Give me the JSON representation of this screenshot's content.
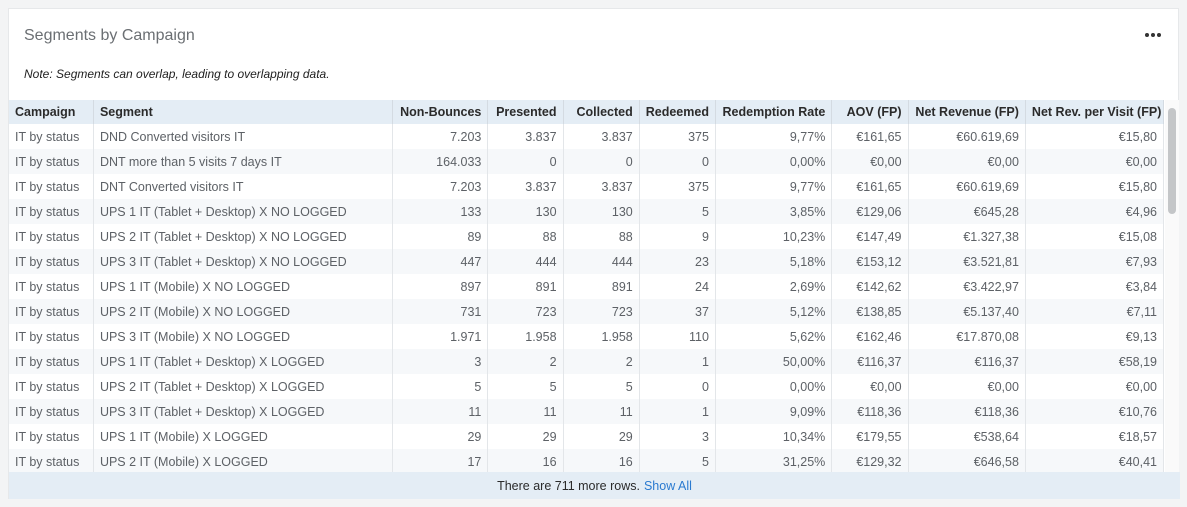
{
  "title": "Segments by Campaign",
  "menu_icon": "ellipsis-icon",
  "note": "Note: Segments can overlap, leading to overlapping data.",
  "columns": [
    "Campaign",
    "Segment",
    "Non-Bounces",
    "Presented",
    "Collected",
    "Redeemed",
    "Redemption Rate",
    "AOV (FP)",
    "Net Revenue (FP)",
    "Net Rev. per Visit (FP)"
  ],
  "rows": [
    [
      "IT by status",
      "DND Converted visitors IT",
      "7.203",
      "3.837",
      "3.837",
      "375",
      "9,77%",
      "€161,65",
      "€60.619,69",
      "€15,80"
    ],
    [
      "IT by status",
      "DNT more than 5 visits 7 days IT",
      "164.033",
      "0",
      "0",
      "0",
      "0,00%",
      "€0,00",
      "€0,00",
      "€0,00"
    ],
    [
      "IT by status",
      "DNT Converted visitors IT",
      "7.203",
      "3.837",
      "3.837",
      "375",
      "9,77%",
      "€161,65",
      "€60.619,69",
      "€15,80"
    ],
    [
      "IT by status",
      "UPS 1 IT (Tablet + Desktop) X NO LOGGED",
      "133",
      "130",
      "130",
      "5",
      "3,85%",
      "€129,06",
      "€645,28",
      "€4,96"
    ],
    [
      "IT by status",
      "UPS 2 IT (Tablet + Desktop) X NO LOGGED",
      "89",
      "88",
      "88",
      "9",
      "10,23%",
      "€147,49",
      "€1.327,38",
      "€15,08"
    ],
    [
      "IT by status",
      "UPS 3 IT (Tablet + Desktop) X NO LOGGED",
      "447",
      "444",
      "444",
      "23",
      "5,18%",
      "€153,12",
      "€3.521,81",
      "€7,93"
    ],
    [
      "IT by status",
      "UPS 1 IT (Mobile) X NO LOGGED",
      "897",
      "891",
      "891",
      "24",
      "2,69%",
      "€142,62",
      "€3.422,97",
      "€3,84"
    ],
    [
      "IT by status",
      "UPS 2 IT (Mobile) X NO LOGGED",
      "731",
      "723",
      "723",
      "37",
      "5,12%",
      "€138,85",
      "€5.137,40",
      "€7,11"
    ],
    [
      "IT by status",
      "UPS 3 IT (Mobile) X NO LOGGED",
      "1.971",
      "1.958",
      "1.958",
      "110",
      "5,62%",
      "€162,46",
      "€17.870,08",
      "€9,13"
    ],
    [
      "IT by status",
      "UPS 1 IT (Tablet + Desktop) X LOGGED",
      "3",
      "2",
      "2",
      "1",
      "50,00%",
      "€116,37",
      "€116,37",
      "€58,19"
    ],
    [
      "IT by status",
      "UPS 2 IT (Tablet + Desktop) X LOGGED",
      "5",
      "5",
      "5",
      "0",
      "0,00%",
      "€0,00",
      "€0,00",
      "€0,00"
    ],
    [
      "IT by status",
      "UPS 3 IT (Tablet + Desktop) X LOGGED",
      "11",
      "11",
      "11",
      "1",
      "9,09%",
      "€118,36",
      "€118,36",
      "€10,76"
    ],
    [
      "IT by status",
      "UPS 1 IT (Mobile) X LOGGED",
      "29",
      "29",
      "29",
      "3",
      "10,34%",
      "€179,55",
      "€538,64",
      "€18,57"
    ],
    [
      "IT by status",
      "UPS 2 IT (Mobile) X LOGGED",
      "17",
      "16",
      "16",
      "5",
      "31,25%",
      "€129,32",
      "€646,58",
      "€40,41"
    ]
  ],
  "footer": {
    "text": "There are 711 more rows.",
    "link_label": "Show All"
  },
  "colors": {
    "header_bg": "#e4edf5",
    "link": "#2a7ad0"
  }
}
